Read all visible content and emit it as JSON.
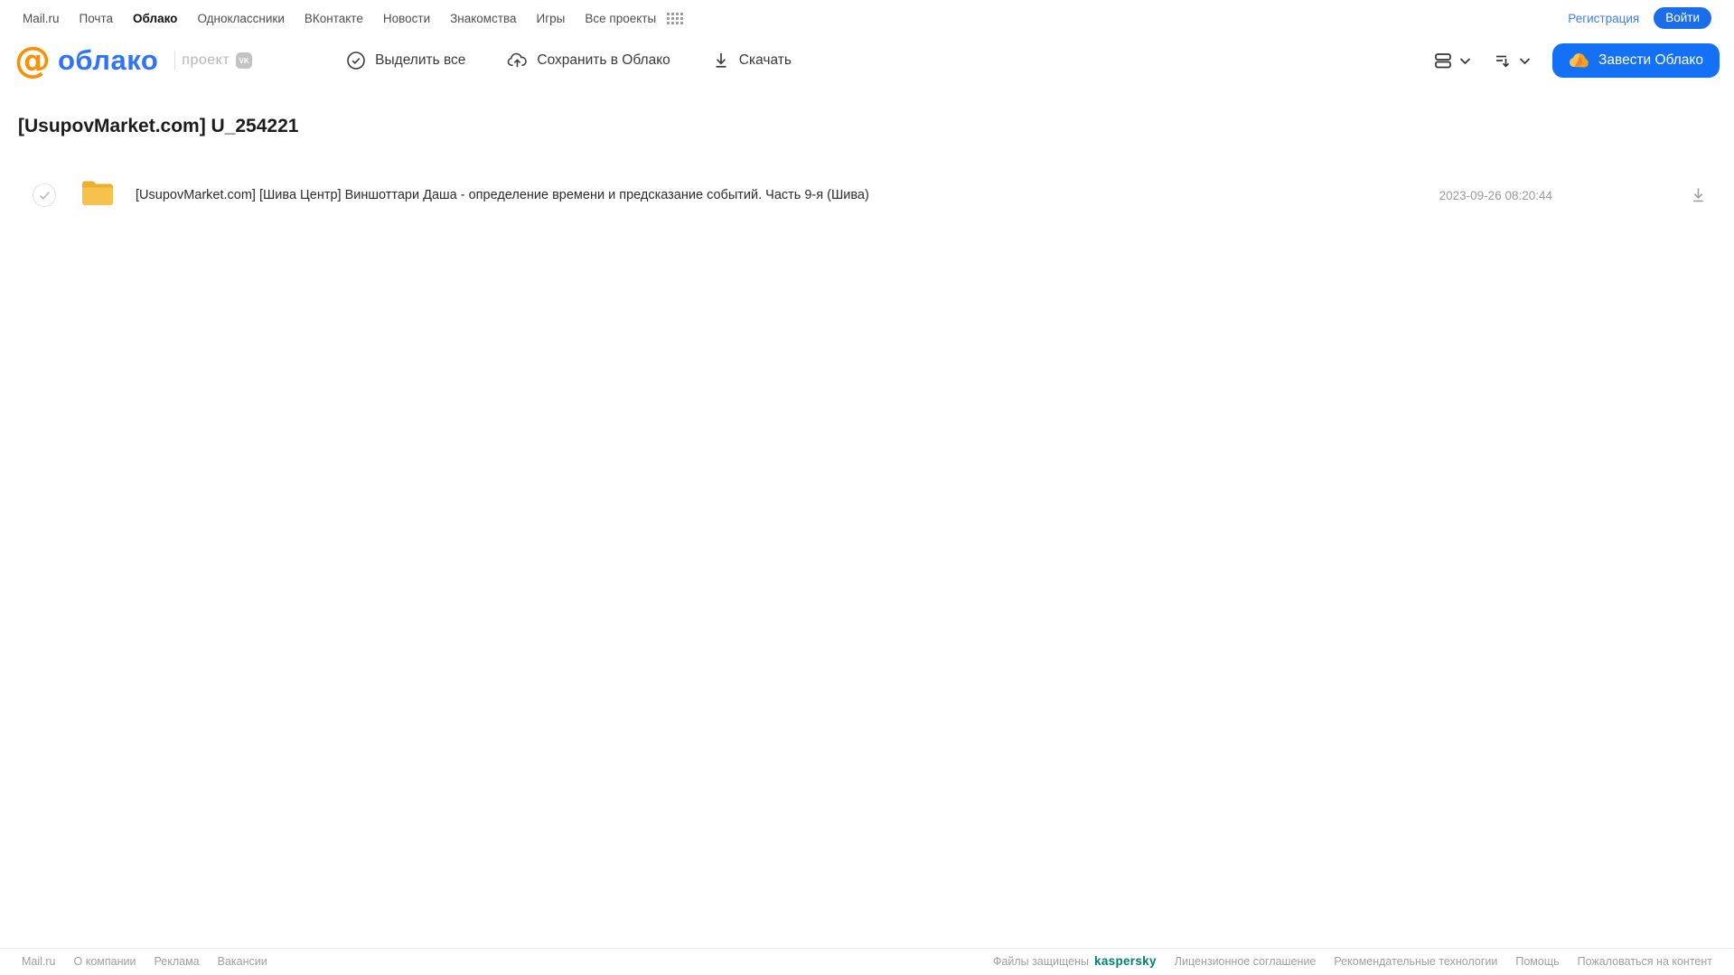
{
  "topnav": {
    "links": [
      {
        "label": "Mail.ru"
      },
      {
        "label": "Почта"
      },
      {
        "label": "Облако"
      },
      {
        "label": "Одноклассники"
      },
      {
        "label": "ВКонтакте"
      },
      {
        "label": "Новости"
      },
      {
        "label": "Знакомства"
      },
      {
        "label": "Игры"
      },
      {
        "label": "Все проекты"
      }
    ],
    "registration_label": "Регистрация",
    "login_label": "Войти"
  },
  "header": {
    "logo_at": "@",
    "logo_text": "облако",
    "project_label": "проект",
    "vk_badge": "VK",
    "toolbar": {
      "select_all_label": "Выделить все",
      "save_to_cloud_label": "Сохранить в Облако",
      "download_label": "Скачать"
    },
    "get_cloud_label": "Завести Облако"
  },
  "main": {
    "title": "[UsupovMarket.com] U_254221",
    "files": [
      {
        "type": "folder",
        "name": "[UsupovMarket.com] [Шива Центр] Виншоттари Даша - определение времени и предсказание событий. Часть 9-я (Шива)",
        "modified": "2023-09-26 08:20:44"
      }
    ]
  },
  "footer": {
    "left_links": [
      {
        "label": "Mail.ru"
      },
      {
        "label": "О компании"
      },
      {
        "label": "Реклама"
      },
      {
        "label": "Вакансии"
      }
    ],
    "protected_label": "Файлы защищены",
    "kaspersky_label": "kaspersky",
    "right_links": [
      {
        "label": "Лицензионное соглашение"
      },
      {
        "label": "Рекомендательные технологии"
      },
      {
        "label": "Помощь"
      },
      {
        "label": "Пожаловаться на контент"
      }
    ]
  },
  "colors": {
    "accent_blue": "#1470f5",
    "link_blue": "#3d7df6",
    "logo_blue": "#2e74f9",
    "logo_orange": "#f59207",
    "folder_yellow": "#f7c24b",
    "kaspersky_green": "#00816f",
    "muted_gray": "#9e9e9e"
  }
}
